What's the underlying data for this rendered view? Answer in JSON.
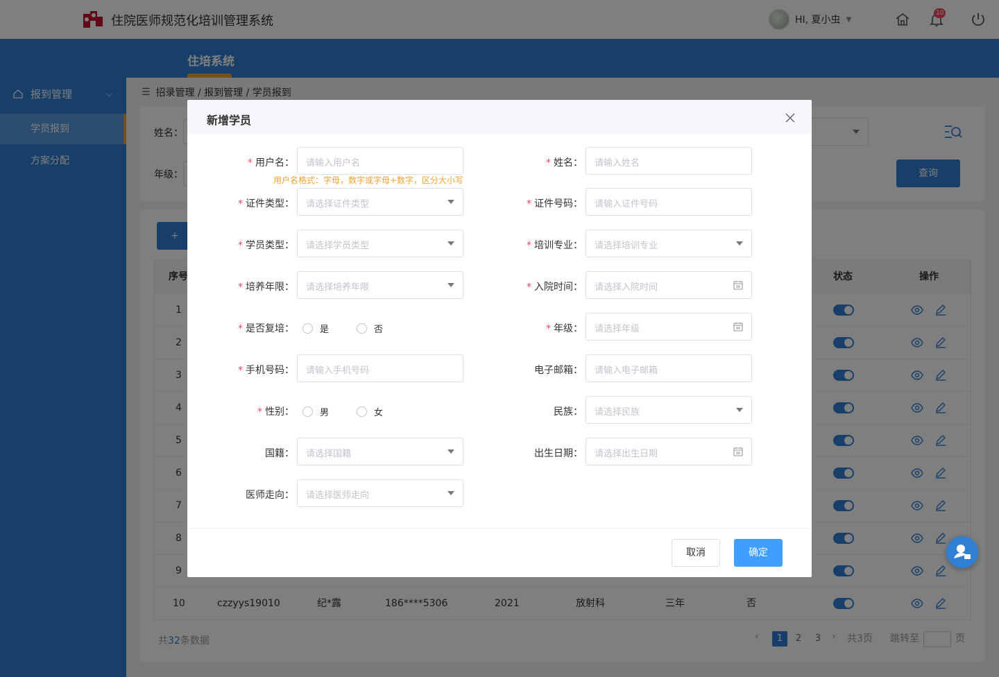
{
  "app": {
    "title": "住院医师规范化培训管理系统"
  },
  "header": {
    "greeting": "HI,  夏小虫",
    "notification_count": "10"
  },
  "nav": {
    "tab": "住培系统"
  },
  "sidebar": {
    "group": "报到管理",
    "items": [
      {
        "label": "学员报到",
        "active": true
      },
      {
        "label": "方案分配",
        "active": false
      }
    ]
  },
  "breadcrumb": "招录管理 / 报到管理 / 学员报到",
  "filters": {
    "name_label": "姓名：",
    "grade_label": "年级：",
    "query_button": "查询"
  },
  "table": {
    "headers": {
      "index": "序号",
      "status": "状态",
      "actions": "操作"
    },
    "rows": [
      {
        "index": "1"
      },
      {
        "index": "2"
      },
      {
        "index": "3"
      },
      {
        "index": "4"
      },
      {
        "index": "5"
      },
      {
        "index": "6"
      },
      {
        "index": "7"
      },
      {
        "index": "8"
      },
      {
        "index": "9"
      },
      {
        "index": "10",
        "username": "czzyys19010",
        "name": "纪*露",
        "phone": "186****5306",
        "year": "2021",
        "dept": "放射科",
        "duration": "三年",
        "retrain": "否"
      }
    ]
  },
  "pagination": {
    "total_prefix": "共",
    "total_count": "32",
    "total_suffix": "条数据",
    "pages": [
      "1",
      "2",
      "3"
    ],
    "total_pages": "共3页",
    "jump_label": "跳转至",
    "page_unit": "页"
  },
  "modal": {
    "title": "新增学员",
    "username_hint": "用户名格式：字母，数字或字母+数字，区分大小写",
    "fields": {
      "username": {
        "label": "用户名：",
        "placeholder": "请输入用户名"
      },
      "name": {
        "label": "姓名：",
        "placeholder": "请输入姓名"
      },
      "id_type": {
        "label": "证件类型：",
        "placeholder": "请选择证件类型"
      },
      "id_number": {
        "label": "证件号码：",
        "placeholder": "请输入证件号码"
      },
      "student_type": {
        "label": "学员类型：",
        "placeholder": "请选择学员类型"
      },
      "major": {
        "label": "培训专业：",
        "placeholder": "请选择培训专业"
      },
      "duration": {
        "label": "培养年限：",
        "placeholder": "请选择培养年限"
      },
      "admission_date": {
        "label": "入院时间：",
        "placeholder": "请选择入院时间"
      },
      "retrain": {
        "label": "是否复培：",
        "option_yes": "是",
        "option_no": "否"
      },
      "grade": {
        "label": "年级：",
        "placeholder": "请选择年级"
      },
      "phone": {
        "label": "手机号码：",
        "placeholder": "请输入手机号码"
      },
      "email": {
        "label": "电子邮箱：",
        "placeholder": "请输入电子邮箱"
      },
      "gender": {
        "label": "性别：",
        "option_male": "男",
        "option_female": "女"
      },
      "ethnicity": {
        "label": "民族：",
        "placeholder": "请选择民族"
      },
      "nationality": {
        "label": "国籍：",
        "placeholder": "请选择国籍"
      },
      "birth_date": {
        "label": "出生日期：",
        "placeholder": "请选择出生日期"
      },
      "career": {
        "label": "医师走向：",
        "placeholder": "请选择医师走向"
      }
    },
    "required_mark": "*",
    "cancel": "取消",
    "confirm": "确定"
  },
  "colors": {
    "primary": "#2f7fd3",
    "accent": "#f0a232",
    "confirm": "#409eff",
    "required": "#f5465b"
  }
}
